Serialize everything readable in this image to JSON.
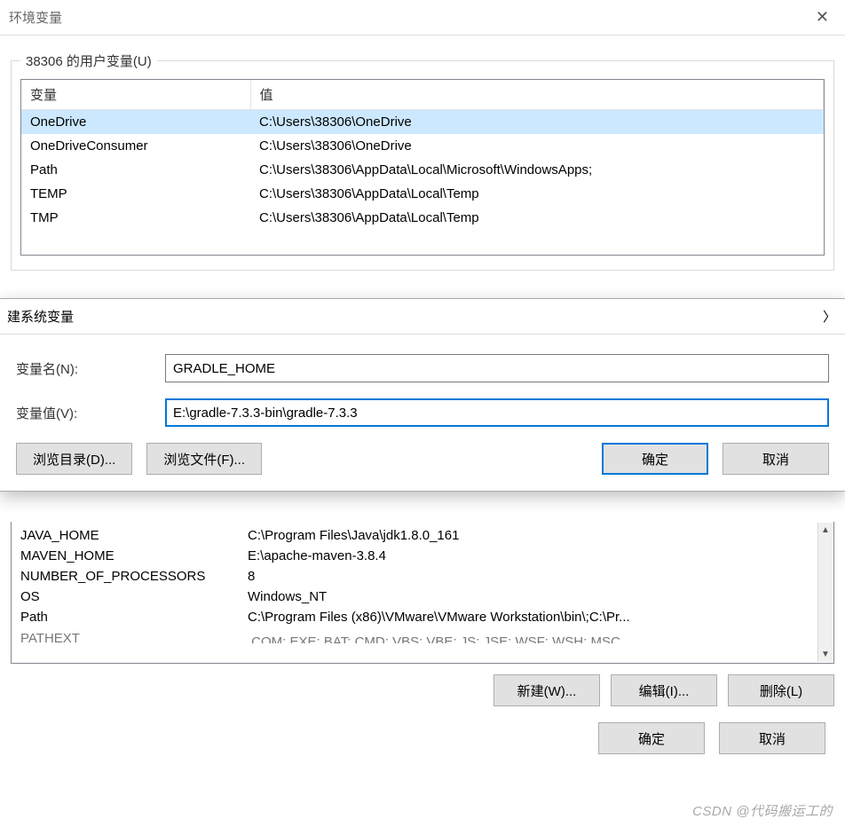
{
  "window": {
    "title": "环境变量"
  },
  "userVars": {
    "legend": "38306 的用户变量(U)",
    "columns": {
      "name": "变量",
      "value": "值"
    },
    "rows": [
      {
        "name": "OneDrive",
        "value": "C:\\Users\\38306\\OneDrive",
        "selected": true
      },
      {
        "name": "OneDriveConsumer",
        "value": "C:\\Users\\38306\\OneDrive"
      },
      {
        "name": "Path",
        "value": "C:\\Users\\38306\\AppData\\Local\\Microsoft\\WindowsApps;"
      },
      {
        "name": "TEMP",
        "value": "C:\\Users\\38306\\AppData\\Local\\Temp"
      },
      {
        "name": "TMP",
        "value": "C:\\Users\\38306\\AppData\\Local\\Temp"
      }
    ]
  },
  "newVarDialog": {
    "title": "建系统变量",
    "nameLabel": "变量名(N):",
    "valueLabel": "变量值(V):",
    "nameValue": "GRADLE_HOME",
    "valueValue": "E:\\gradle-7.3.3-bin\\gradle-7.3.3",
    "browseDir": "浏览目录(D)...",
    "browseFile": "浏览文件(F)...",
    "ok": "确定",
    "cancel": "取消"
  },
  "sysVars": {
    "rows": [
      {
        "name": "JAVA_HOME",
        "value": "C:\\Program Files\\Java\\jdk1.8.0_161"
      },
      {
        "name": "MAVEN_HOME",
        "value": "E:\\apache-maven-3.8.4"
      },
      {
        "name": "NUMBER_OF_PROCESSORS",
        "value": "8"
      },
      {
        "name": "OS",
        "value": "Windows_NT"
      },
      {
        "name": "Path",
        "value": "C:\\Program Files (x86)\\VMware\\VMware Workstation\\bin\\;C:\\Pr..."
      }
    ],
    "cutoff": {
      "name": "PATHEXT",
      "value": ".COM;.EXE;.BAT;.CMD;.VBS;.VBE;.JS;.JSE;.WSF;.WSH;.MSC"
    },
    "buttons": {
      "new": "新建(W)...",
      "edit": "编辑(I)...",
      "delete": "删除(L)"
    }
  },
  "mainButtons": {
    "ok": "确定",
    "cancel": "取消"
  },
  "watermark": "CSDN @代码搬运工的"
}
